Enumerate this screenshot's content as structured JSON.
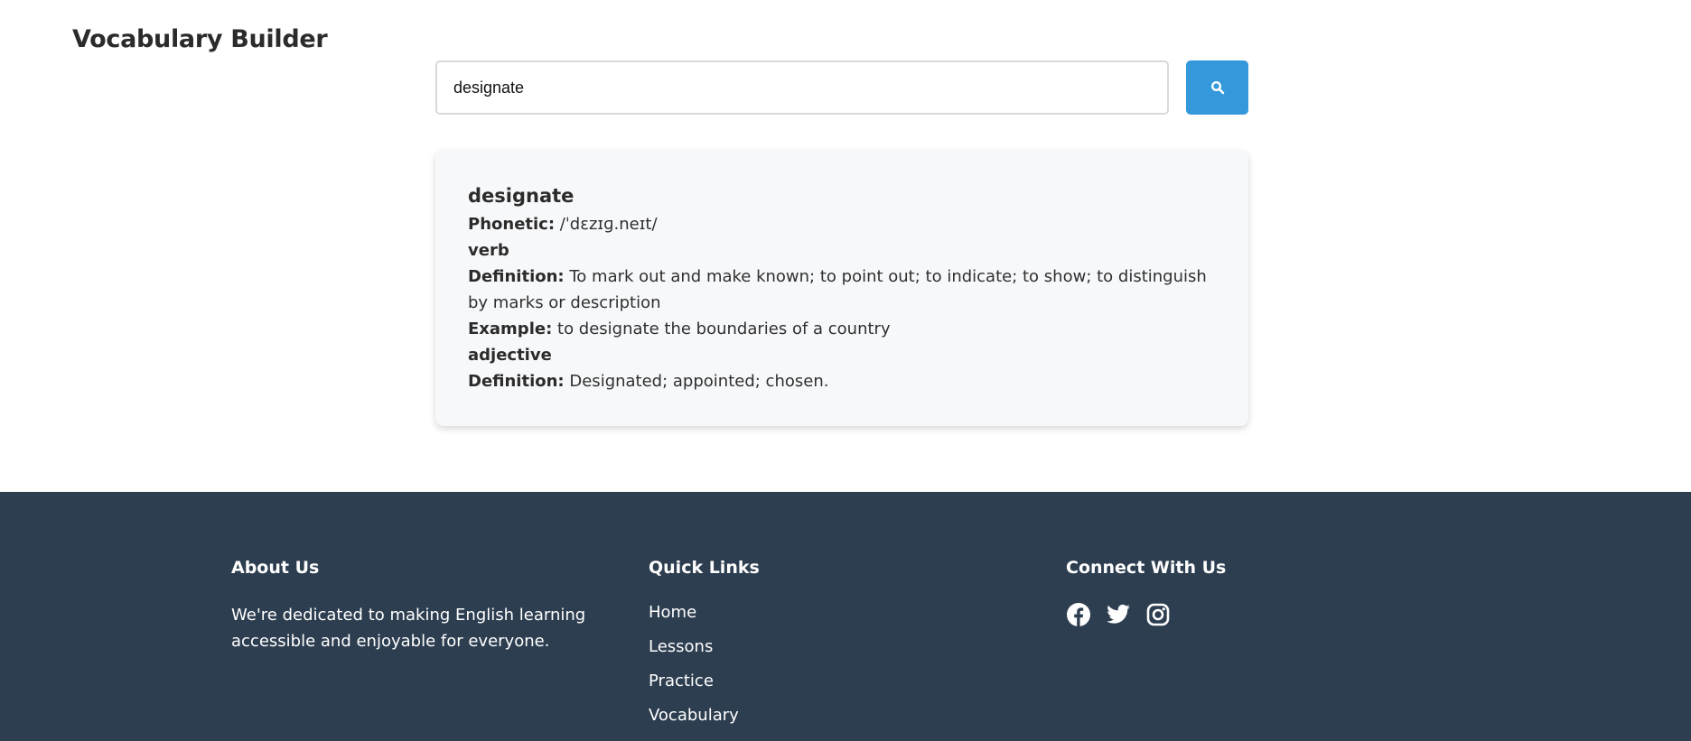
{
  "header": {
    "title": "Vocabulary Builder"
  },
  "search": {
    "value": "designate",
    "button_icon": "search-icon"
  },
  "result": {
    "word": "designate",
    "phonetic_label": "Phonetic:",
    "phonetic": "/ˈdɛzɪɡ.neɪt/",
    "meanings": [
      {
        "part_of_speech": "verb",
        "definition_label": "Definition:",
        "definition": "To mark out and make known; to point out; to indicate; to show; to distinguish by marks or description",
        "example_label": "Example:",
        "example": "to designate the boundaries of a country"
      },
      {
        "part_of_speech": "adjective",
        "definition_label": "Definition:",
        "definition": "Designated; appointed; chosen."
      }
    ]
  },
  "footer": {
    "about": {
      "heading": "About Us",
      "text": "We're dedicated to making English learning accessible and enjoyable for everyone."
    },
    "quick_links": {
      "heading": "Quick Links",
      "items": [
        "Home",
        "Lessons",
        "Practice",
        "Vocabulary"
      ]
    },
    "connect": {
      "heading": "Connect With Us",
      "icons": [
        "facebook-icon",
        "twitter-icon",
        "instagram-icon"
      ]
    }
  },
  "colors": {
    "accent": "#3498db",
    "footer_bg": "#2d3e50",
    "card_bg": "#f7f8fa"
  }
}
